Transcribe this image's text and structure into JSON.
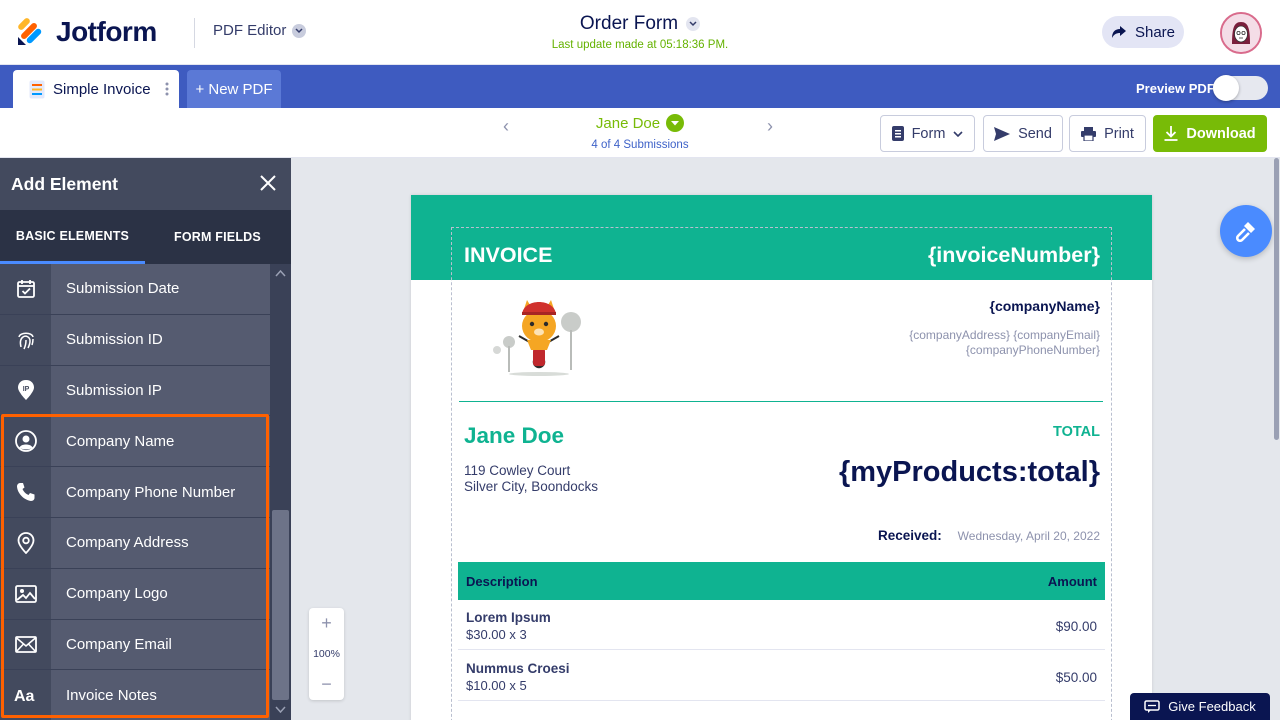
{
  "header": {
    "brand": "Jotform",
    "product": "PDF Editor",
    "form_title": "Order Form",
    "last_update": "Last update made at 05:18:36 PM.",
    "share_label": "Share"
  },
  "tabs": {
    "doc_tab": "Simple Invoice",
    "new_pdf": "+ New PDF",
    "preview_label": "Preview PDF",
    "preview_on": false
  },
  "toolbar": {
    "submission_name": "Jane Doe",
    "submission_count": "4 of 4 Submissions",
    "form_label": "Form",
    "send_label": "Send",
    "print_label": "Print",
    "download_label": "Download"
  },
  "panel": {
    "title": "Add Element",
    "tabs": [
      "BASIC ELEMENTS",
      "FORM FIELDS"
    ],
    "items": [
      {
        "label": "Submission Date",
        "icon": "calendar-check-icon"
      },
      {
        "label": "Submission ID",
        "icon": "fingerprint-icon"
      },
      {
        "label": "Submission IP",
        "icon": "ip-pin-icon"
      },
      {
        "label": "Company Name",
        "icon": "user-circle-icon"
      },
      {
        "label": "Company Phone Number",
        "icon": "phone-icon"
      },
      {
        "label": "Company Address",
        "icon": "location-pin-icon"
      },
      {
        "label": "Company Logo",
        "icon": "image-icon"
      },
      {
        "label": "Company Email",
        "icon": "envelope-icon"
      },
      {
        "label": "Invoice Notes",
        "icon": "text-aa-icon"
      }
    ]
  },
  "zoom": {
    "level": "100%"
  },
  "invoice": {
    "title": "INVOICE",
    "number": "{invoiceNumber}",
    "company_name": "{companyName}",
    "company_line1": "{companyAddress} {companyEmail}",
    "company_line2": "{companyPhoneNumber}",
    "client_name": "Jane Doe",
    "address_line1": "119 Cowley Court",
    "address_line2": "Silver City, Boondocks",
    "total_label": "TOTAL",
    "total_value": "{myProducts:total}",
    "received_label": "Received:",
    "received_value": "Wednesday, April 20, 2022",
    "table_headers": {
      "description": "Description",
      "amount": "Amount"
    },
    "rows": [
      {
        "name": "Lorem Ipsum",
        "qty": "$30.00 x 3",
        "amount": "$90.00"
      },
      {
        "name": "Nummus Croesi",
        "qty": "$10.00 x 5",
        "amount": "$50.00"
      }
    ]
  },
  "feedback_label": "Give Feedback",
  "colors": {
    "brand_blue": "#3e5bc0",
    "accent_green": "#0fb391",
    "download_green": "#78bb07",
    "highlight": "#ff6100"
  }
}
